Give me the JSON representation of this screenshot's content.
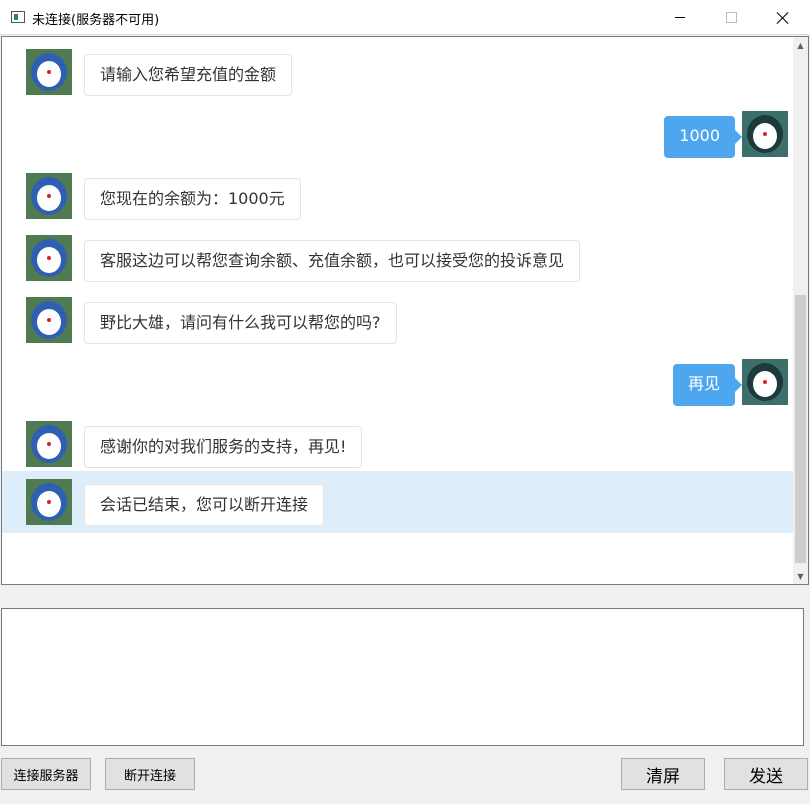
{
  "window": {
    "title": "未连接(服务器不可用)"
  },
  "chat": {
    "messages": [
      {
        "side": "left",
        "text": "请输入您希望充值的金额"
      },
      {
        "side": "right",
        "text": "1000"
      },
      {
        "side": "left",
        "text": "您现在的余额为：1000元"
      },
      {
        "side": "left",
        "text": "客服这边可以帮您查询余额、充值余额，也可以接受您的投诉意见"
      },
      {
        "side": "left",
        "text": "野比大雄，请问有什么我可以帮您的吗?"
      },
      {
        "side": "right",
        "text": "再见"
      },
      {
        "side": "left",
        "text": "感谢你的对我们服务的支持，再见!"
      },
      {
        "side": "left",
        "text": "会话已结束，您可以断开连接",
        "highlighted": true
      }
    ],
    "colors": {
      "right_bubble": "#4da6ee",
      "highlight": "#ddeefa"
    }
  },
  "input": {
    "value": ""
  },
  "buttons": {
    "connect": "连接服务器",
    "disconnect": "断开连接",
    "clear": "清屏",
    "send": "发送"
  },
  "icons": {
    "avatar_bot": "doraemon-avatar-icon",
    "avatar_user": "user-avatar-icon"
  }
}
